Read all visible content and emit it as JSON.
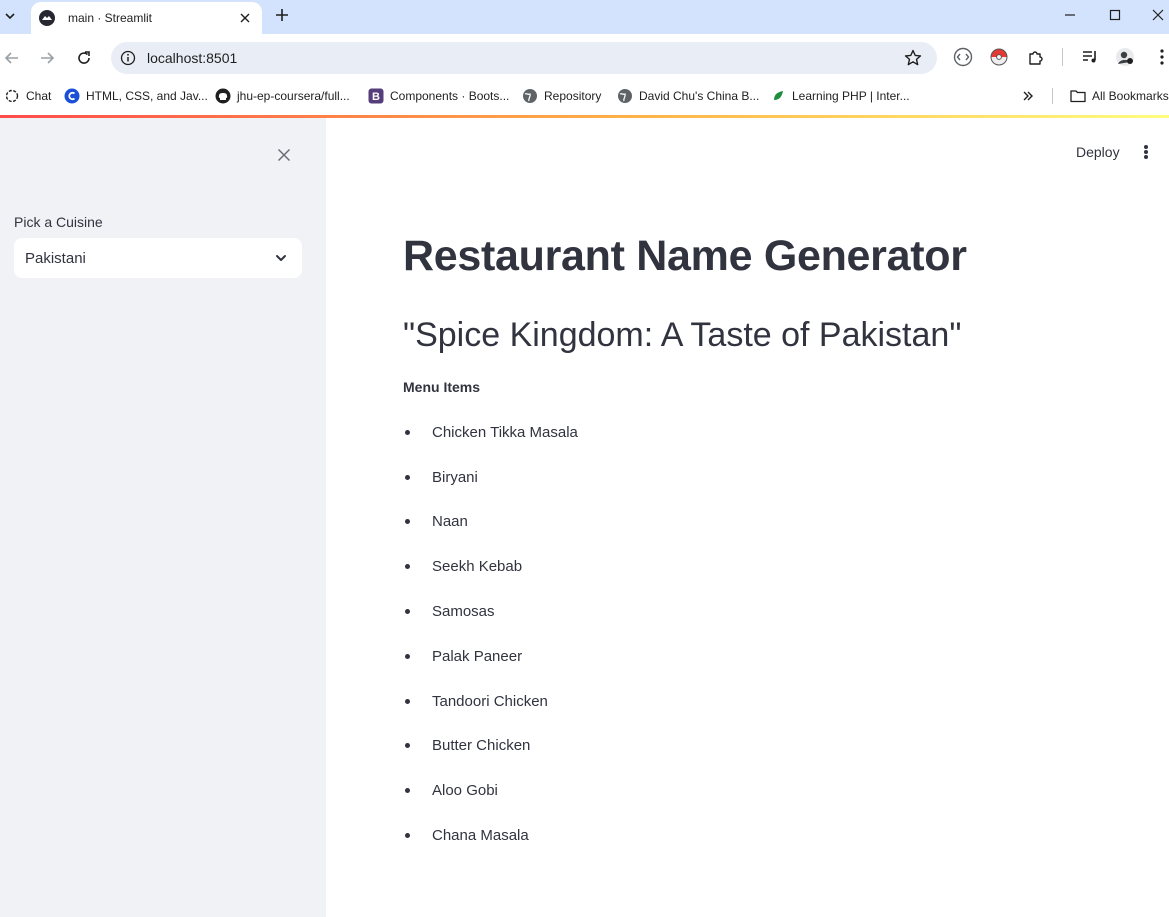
{
  "browser": {
    "tab_title": "main · Streamlit",
    "url": "localhost:8501",
    "bookmarks": [
      "Chat",
      "HTML, CSS, and Jav...",
      "jhu-ep-coursera/full...",
      "Components · Boots...",
      "Repository",
      "David Chu's China B...",
      "Learning PHP | Inter..."
    ],
    "all_bookmarks": "All Bookmarks"
  },
  "app": {
    "deploy_label": "Deploy",
    "sidebar": {
      "select_label": "Pick a Cuisine",
      "select_value": "Pakistani"
    },
    "title": "Restaurant Name Generator",
    "restaurant_name": "\"Spice Kingdom: A Taste of Pakistan\"",
    "menu_heading": "Menu Items",
    "menu_items": [
      "Chicken Tikka Masala",
      "Biryani",
      "Naan",
      "Seekh Kebab",
      "Samosas",
      "Palak Paneer",
      "Tandoori Chicken",
      "Butter Chicken",
      "Aloo Gobi",
      "Chana Masala"
    ]
  },
  "colors": {
    "accent": "#ff4b4b",
    "text": "#31333f",
    "sidebar_bg": "#f0f2f6",
    "tabstrip_bg": "#d3e3fd"
  }
}
